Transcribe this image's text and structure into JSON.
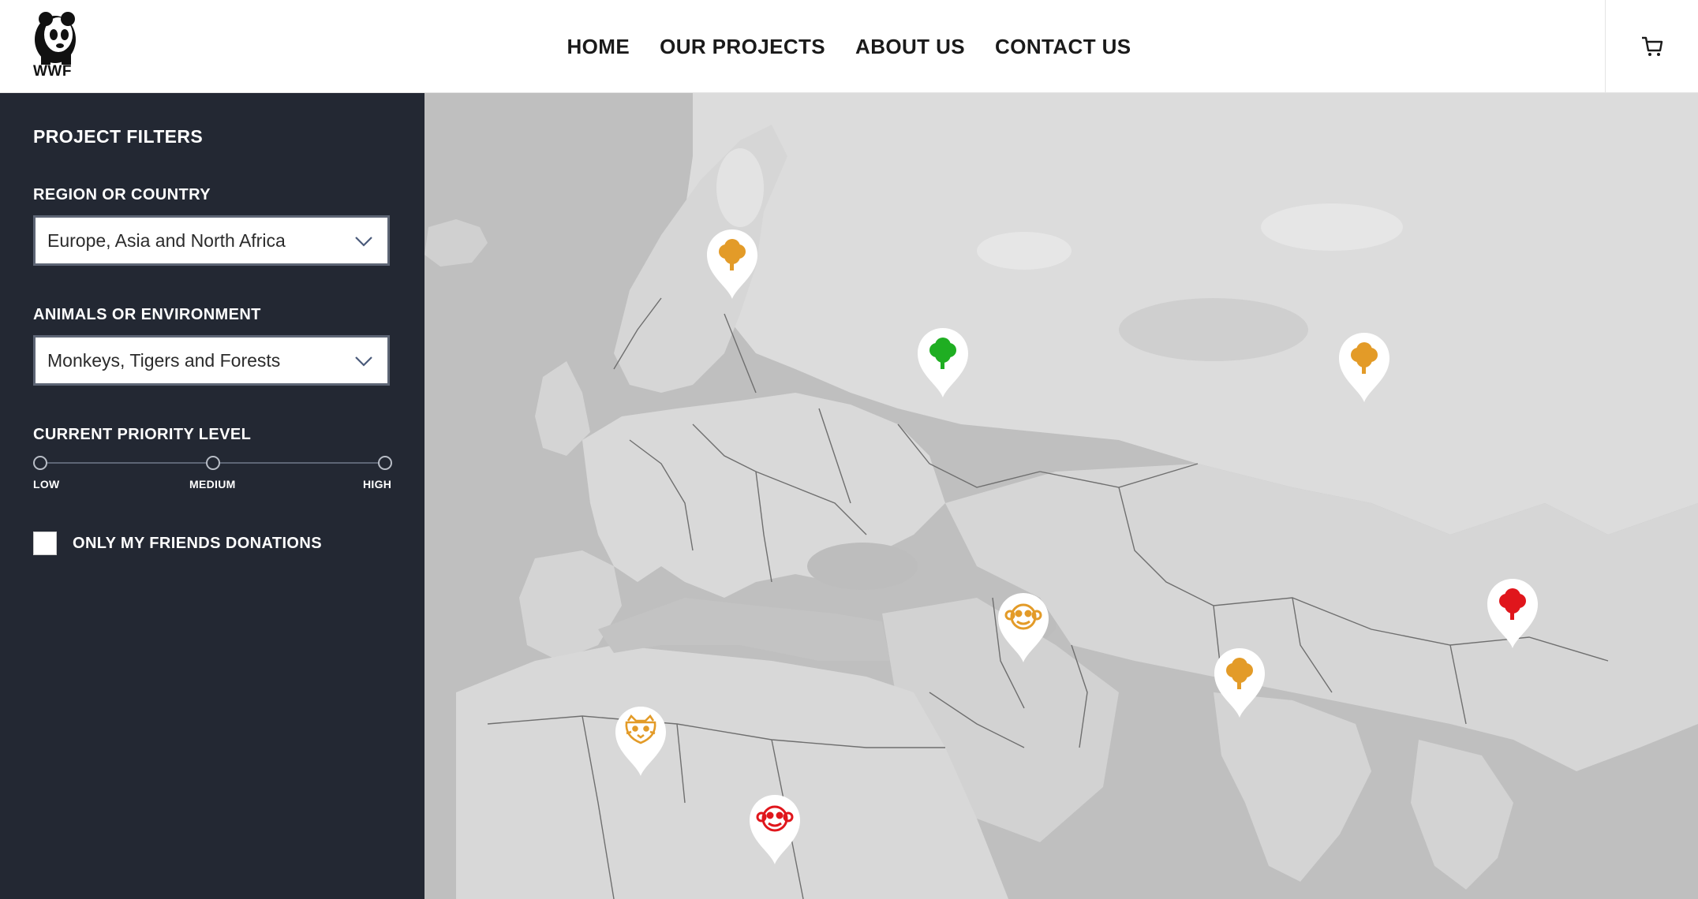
{
  "header": {
    "logo_text": "WWF",
    "nav": [
      "HOME",
      "OUR PROJECTS",
      "ABOUT US",
      "CONTACT US"
    ]
  },
  "sidebar": {
    "title": "PROJECT FILTERS",
    "region": {
      "label": "REGION OR COUNTRY",
      "value": "Europe, Asia and North Africa"
    },
    "animals": {
      "label": "ANIMALS OR ENVIRONMENT",
      "value": "Monkeys, Tigers and Forests"
    },
    "priority": {
      "label": "CURRENT PRIORITY LEVEL",
      "levels": [
        "LOW",
        "MEDIUM",
        "HIGH"
      ]
    },
    "friends": {
      "label": "ONLY MY FRIENDS DONATIONS",
      "checked": false
    }
  },
  "colors": {
    "sidebar_bg": "#232833",
    "orange": "#e39b28",
    "green": "#1fae22",
    "red": "#e0161c"
  },
  "map": {
    "pins": [
      {
        "name": "forest-pin-scandinavia",
        "icon": "tree-icon",
        "color": "#e39b28"
      },
      {
        "name": "forest-pin-russia-west",
        "icon": "tree-icon",
        "color": "#1fae22"
      },
      {
        "name": "forest-pin-siberia",
        "icon": "tree-icon",
        "color": "#e39b28"
      },
      {
        "name": "monkey-pin-iran",
        "icon": "monkey-icon",
        "color": "#e39b28"
      },
      {
        "name": "forest-pin-india",
        "icon": "tree-icon",
        "color": "#e39b28"
      },
      {
        "name": "forest-pin-china",
        "icon": "tree-icon",
        "color": "#e0161c"
      },
      {
        "name": "tiger-pin-sahara",
        "icon": "tiger-icon",
        "color": "#e39b28"
      },
      {
        "name": "monkey-pin-sudan",
        "icon": "monkey-icon",
        "color": "#e0161c"
      }
    ]
  }
}
